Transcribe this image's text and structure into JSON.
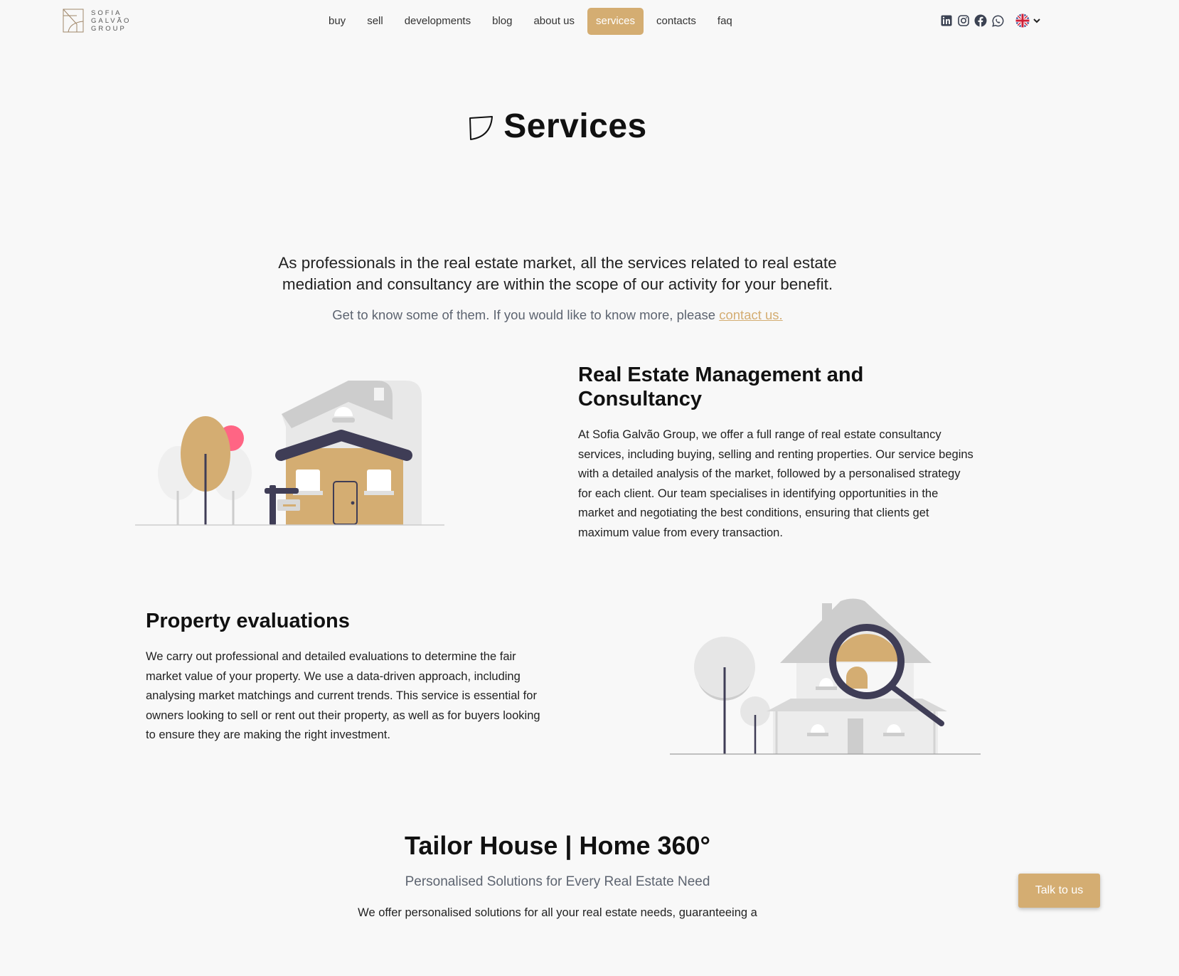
{
  "brand": {
    "logo_lines": [
      "SOFIA",
      "GALVÃO",
      "GROUP"
    ]
  },
  "nav": {
    "items": [
      {
        "label": "buy"
      },
      {
        "label": "sell"
      },
      {
        "label": "developments"
      },
      {
        "label": "blog"
      },
      {
        "label": "about us"
      },
      {
        "label": "services",
        "active": true
      },
      {
        "label": "contacts"
      },
      {
        "label": "faq"
      }
    ]
  },
  "socials": [
    "linkedin-icon",
    "instagram-icon",
    "facebook-icon",
    "whatsapp-icon"
  ],
  "language": {
    "flag": "uk-flag-icon"
  },
  "hero": {
    "title": "Services"
  },
  "intro": {
    "text": "As professionals in the real estate market, all the services related to real estate mediation and consultancy are within the scope of our activity for your benefit.",
    "sub_text": "Get to know some of them. If you would like to know more, please ",
    "sub_link": "contact us."
  },
  "sections": [
    {
      "title": "Real Estate Management and Consultancy",
      "body": "At Sofia Galvão Group, we offer a full range of real estate consultancy services, including buying, selling and renting properties. Our service begins with a detailed analysis of the market, followed by a personalised strategy for each client. Our team specialises in identifying opportunities in the market and negotiating the best conditions, ensuring that clients get maximum value from every transaction."
    },
    {
      "title": "Property evaluations",
      "body": "We carry out professional and detailed evaluations to determine the fair market value of your property. We use a data-driven approach, including analysing market matchings and current trends. This service is essential for owners looking to sell or rent out their property, as well as for buyers looking to ensure they are making the right investment."
    }
  ],
  "tailor": {
    "title": "Tailor House | Home 360°",
    "subtitle": "Personalised Solutions for Every Real Estate Need",
    "text": "We offer personalised solutions for all your real estate needs, guaranteeing a"
  },
  "chat": {
    "label": "Talk to us"
  },
  "colors": {
    "accent": "#d4ad72",
    "dark": "#3f3d56",
    "pink": "#ff6584",
    "background": "#f8f8f8"
  }
}
